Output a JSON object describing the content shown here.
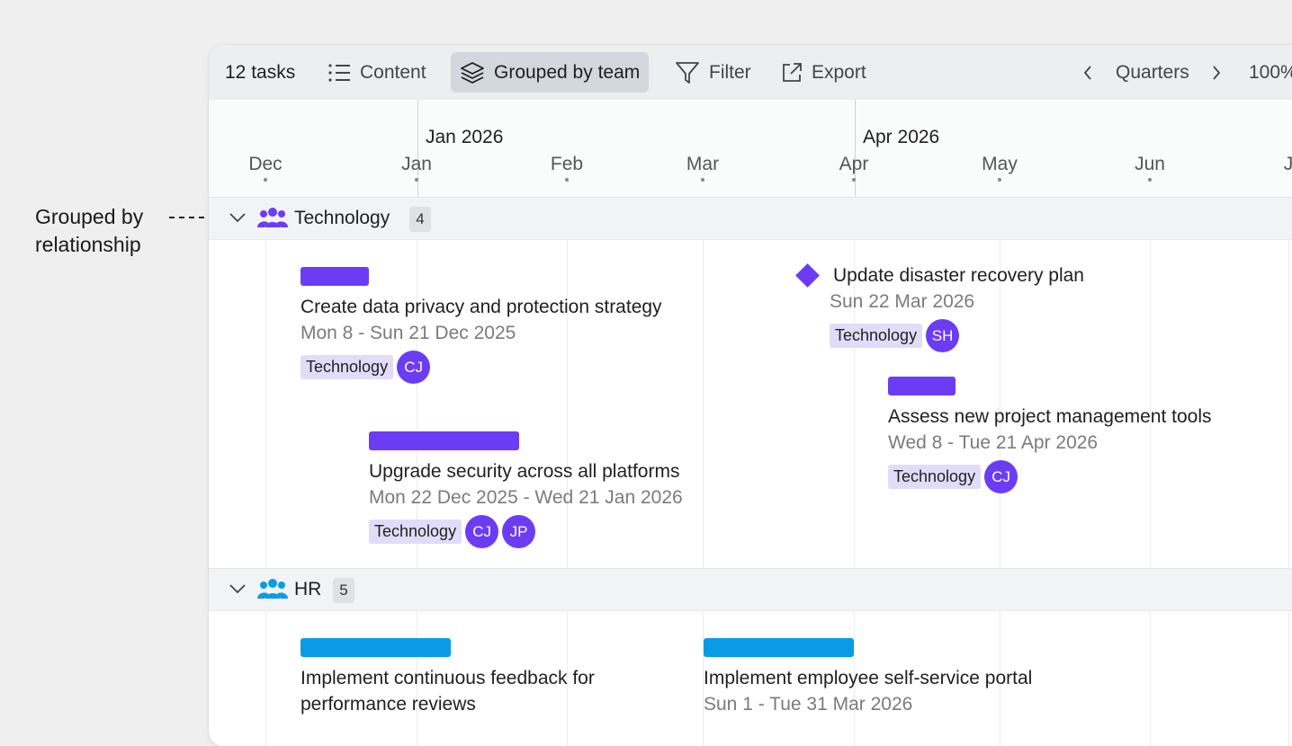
{
  "annotation": {
    "line1": "Grouped by",
    "line2": "relationship"
  },
  "toolbar": {
    "task_count": "12 tasks",
    "content_label": "Content",
    "grouped_label": "Grouped by team",
    "filter_label": "Filter",
    "export_label": "Export",
    "period_label": "Quarters",
    "zoom_label": "100%"
  },
  "timeline": {
    "quarters": [
      "Jan 2026",
      "Apr 2026"
    ],
    "months": [
      "Dec",
      "Jan",
      "Feb",
      "Mar",
      "Apr",
      "May",
      "Jun",
      "J"
    ]
  },
  "colors": {
    "technology": "#6c3cf5",
    "hr": "#0a9be6"
  },
  "groups": [
    {
      "name": "Technology",
      "count": "4",
      "icon": "team-icon",
      "tasks": [
        {
          "title": "Create data privacy and protection strategy",
          "dates": "Mon 8 - Sun 21 Dec 2025",
          "tag": "Technology",
          "assignees": [
            "CJ"
          ]
        },
        {
          "title": "Upgrade security across all platforms",
          "dates": "Mon 22 Dec 2025 - Wed 21 Jan 2026",
          "tag": "Technology",
          "assignees": [
            "CJ",
            "JP"
          ]
        },
        {
          "title": "Update disaster recovery plan",
          "dates": "Sun 22 Mar 2026",
          "tag": "Technology",
          "assignees": [
            "SH"
          ],
          "milestone": true
        },
        {
          "title": "Assess new project management tools",
          "dates": "Wed 8 - Tue 21 Apr 2026",
          "tag": "Technology",
          "assignees": [
            "CJ"
          ]
        }
      ]
    },
    {
      "name": "HR",
      "count": "5",
      "icon": "team-icon",
      "tasks": [
        {
          "title_line1": "Implement continuous feedback for",
          "title_line2": "performance reviews"
        },
        {
          "title": "Implement employee self-service portal",
          "dates": "Sun 1 - Tue 31 Mar 2026"
        }
      ]
    }
  ]
}
